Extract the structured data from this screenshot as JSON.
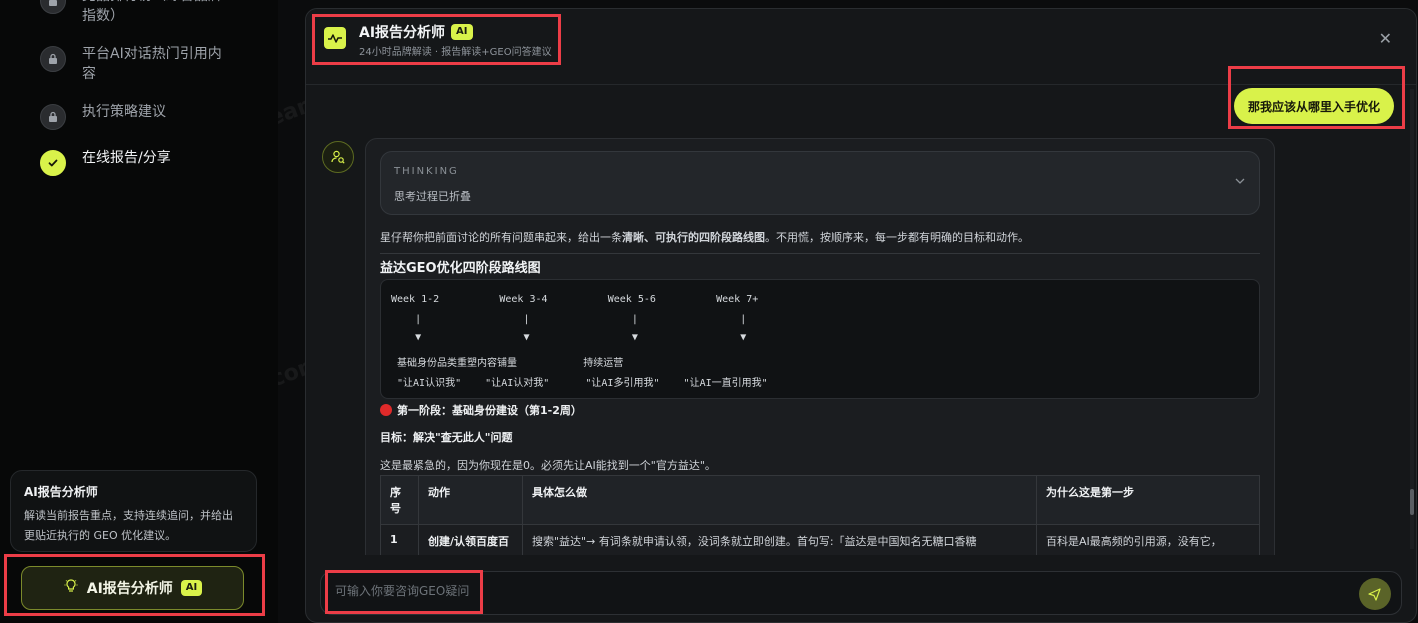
{
  "sidebar": {
    "steps": [
      {
        "label": "竞品排行榜（综合品牌指数）",
        "state": "locked"
      },
      {
        "label": "平台AI对话热门引用内容",
        "state": "locked"
      },
      {
        "label": "执行策略建议",
        "state": "locked"
      },
      {
        "label": "在线报告/分享",
        "state": "done"
      }
    ],
    "card": {
      "title": "AI报告分析师",
      "desc": "解读当前报告重点，支持连续追问，并给出更贴近执行的 GEO 优化建议。"
    },
    "button_label": "AI报告分析师",
    "ai_badge": "AI"
  },
  "header": {
    "title": "AI报告分析师",
    "badge": "AI",
    "subtitle": "24小时品牌解读 · 报告解读+GEO问答建议"
  },
  "chat": {
    "user_message": "那我应该从哪里入手优化",
    "thinking": {
      "label": "THINKING",
      "text": "思考过程已折叠"
    },
    "intro_prefix": "星仔帮你把前面讨论的所有问题串起来，给出一条",
    "intro_bold": "清晰、可执行的四阶段路线图",
    "intro_suffix": "。不用慌，按顺序来，每一步都有明确的目标和动作。",
    "roadmap_title": "益达GEO优化四阶段路线图",
    "code_lines": [
      "Week 1-2          Week 3-4          Week 5-6          Week 7+",
      "    |                 |                 |                 |",
      "    ▼                 ▼                 ▼                 ▼",
      " 基础身份品类重塑内容铺量           持续运营",
      " \"让AI认识我\"    \"让AI认对我\"      \"让AI多引用我\"    \"让AI一直引用我\""
    ],
    "phase1_title": "第一阶段：基础身份建设（第1-2周）",
    "goal": "目标：解决\"查无此人\"问题",
    "para": "这是最紧急的，因为你现在是0。必须先让AI能找到一个\"官方益达\"。",
    "table": {
      "headers": [
        "序号",
        "动作",
        "具体怎么做",
        "为什么这是第一步"
      ],
      "rows": [
        [
          "1",
          "创建/认领百度百",
          "搜索\"益达\"→ 有词条就申请认领，没词条就立即创建。首句写:「益达是中国知名无糖口香糖",
          "百科是AI最高频的引用源，没有它，"
        ]
      ]
    }
  },
  "input": {
    "placeholder": "可输入你要咨询GEO疑问"
  },
  "watermark": "YOOTeam@sougeo.com",
  "colors": {
    "accent": "#d9f24a",
    "highlight": "#ec3d47"
  }
}
